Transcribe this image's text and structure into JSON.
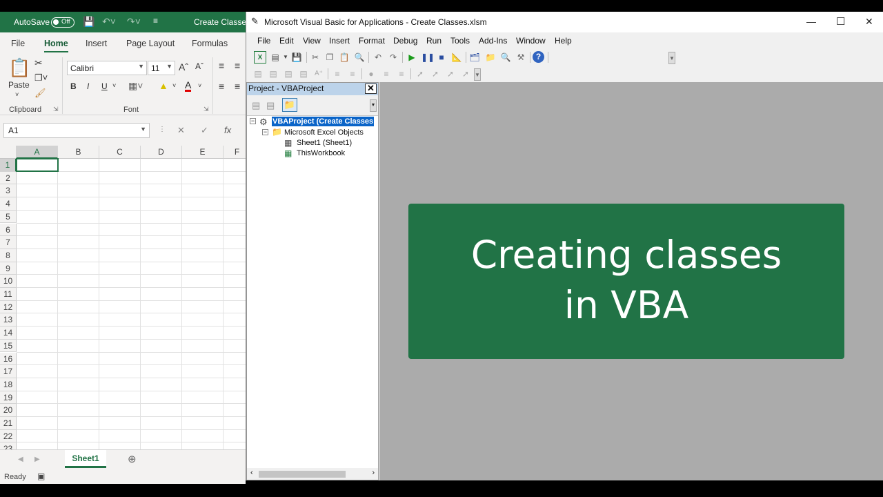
{
  "excel": {
    "autosave_label": "AutoSave",
    "autosave_state": "Off",
    "title": "Create Classes.",
    "tabs": [
      "File",
      "Home",
      "Insert",
      "Page Layout",
      "Formulas"
    ],
    "active_tab": "Home",
    "clipboard": {
      "paste_label": "Paste",
      "group_label": "Clipboard"
    },
    "font": {
      "name": "Calibri",
      "size": "11",
      "group_label": "Font",
      "bold": "B",
      "italic": "I",
      "underline": "U"
    },
    "name_box": "A1",
    "columns": [
      "A",
      "B",
      "C",
      "D",
      "E",
      "F"
    ],
    "rows": [
      "1",
      "2",
      "3",
      "4",
      "5",
      "6",
      "7",
      "8",
      "9",
      "10",
      "11",
      "12",
      "13",
      "14",
      "15",
      "16",
      "17",
      "18",
      "19",
      "20",
      "21",
      "22",
      "23"
    ],
    "sheet_tab": "Sheet1",
    "status": "Ready",
    "colors": {
      "brand": "#217346"
    }
  },
  "vbe": {
    "title": "Microsoft Visual Basic for Applications - Create Classes.xlsm",
    "menu": [
      "File",
      "Edit",
      "View",
      "Insert",
      "Format",
      "Debug",
      "Run",
      "Tools",
      "Add-Ins",
      "Window",
      "Help"
    ],
    "project_title": "Project - VBAProject",
    "tree": {
      "root": "VBAProject (Create Classes",
      "folder": "Microsoft Excel Objects",
      "items": [
        "Sheet1 (Sheet1)",
        "ThisWorkbook"
      ]
    },
    "banner": {
      "line1": "Creating classes",
      "line2": "in VBA"
    }
  }
}
